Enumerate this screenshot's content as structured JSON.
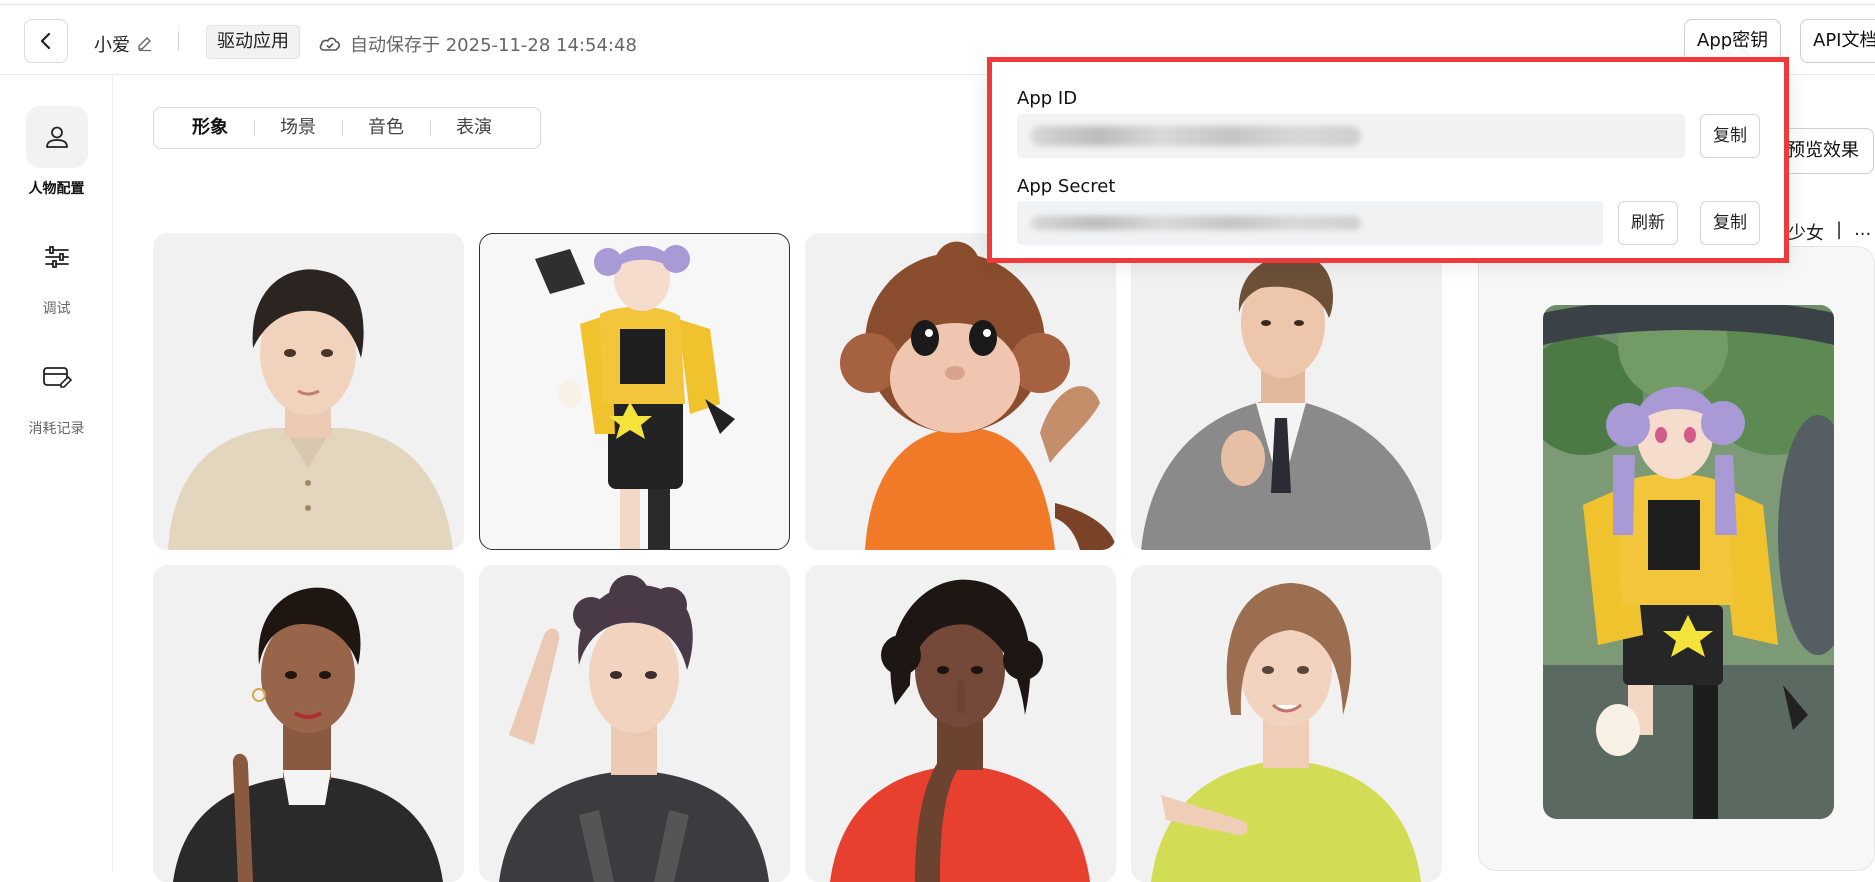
{
  "header": {
    "app_name": "小爱",
    "app_type_tag": "驱动应用",
    "autosave_text": "自动保存于 2025-11-28 14:54:48",
    "app_key_button": "App密钥",
    "api_doc_button": "API文档"
  },
  "sidebar": {
    "items": [
      {
        "label": "人物配置",
        "icon": "person-icon",
        "active": true
      },
      {
        "label": "调试",
        "icon": "sliders-icon",
        "active": false
      },
      {
        "label": "消耗记录",
        "icon": "card-edit-icon",
        "active": false
      }
    ]
  },
  "tabs": [
    {
      "label": "形象",
      "active": true
    },
    {
      "label": "场景",
      "active": false
    },
    {
      "label": "音色",
      "active": false
    },
    {
      "label": "表演",
      "active": false
    }
  ],
  "avatars": [
    {
      "name": "short-hair-woman-beige-sweater",
      "selected": false
    },
    {
      "name": "anime-girl-purple-hair-yellow-jacket",
      "selected": true
    },
    {
      "name": "cartoon-monkey-orange-shirt",
      "selected": false
    },
    {
      "name": "man-gray-suit",
      "selected": false
    },
    {
      "name": "woman-black-leather-jacket",
      "selected": false
    },
    {
      "name": "young-man-curly-hair-overalls",
      "selected": false
    },
    {
      "name": "woman-curly-hair-red-top",
      "selected": false
    },
    {
      "name": "woman-bob-lime-jacket",
      "selected": false
    }
  ],
  "preview": {
    "button_label": "预览效果",
    "tag": "少女",
    "more": "..."
  },
  "key_popover": {
    "app_id_label": "App ID",
    "app_secret_label": "App Secret",
    "copy_label": "复制",
    "refresh_label": "刷新"
  },
  "colors": {
    "highlight": "#ee3a3a",
    "card_bg": "#f1f1f1",
    "field_bg": "#f1f2f4"
  }
}
